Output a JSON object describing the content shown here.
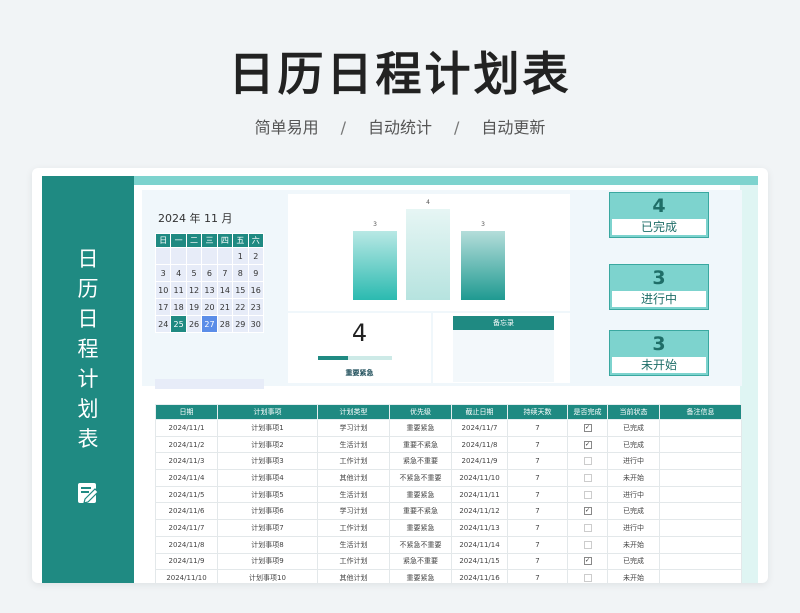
{
  "header": {
    "title": "日历日程计划表",
    "subtitle": [
      "简单易用",
      "自动统计",
      "自动更新"
    ],
    "separator": "/"
  },
  "sidebar": {
    "title_chars": [
      "日",
      "历",
      "日",
      "程",
      "计",
      "划",
      "表"
    ],
    "icon": "edit-icon"
  },
  "calendar": {
    "year": "2024",
    "year_unit": "年",
    "month": "11",
    "month_unit": "月",
    "weekdays": [
      "日",
      "一",
      "二",
      "三",
      "四",
      "五",
      "六"
    ],
    "weeks": [
      [
        "",
        "",
        "",
        "",
        "",
        "1",
        "2"
      ],
      [
        "3",
        "4",
        "5",
        "6",
        "7",
        "8",
        "9"
      ],
      [
        "10",
        "11",
        "12",
        "13",
        "14",
        "15",
        "16"
      ],
      [
        "17",
        "18",
        "19",
        "20",
        "21",
        "22",
        "23"
      ],
      [
        "24",
        "25",
        "26",
        "27",
        "28",
        "29",
        "30"
      ]
    ],
    "highlight_primary": "25",
    "highlight_secondary": "27"
  },
  "chart_data": {
    "type": "bar",
    "categories": [
      "",
      "",
      ""
    ],
    "values": [
      3,
      4,
      3
    ],
    "ylim": [
      0,
      4.2
    ],
    "grid": false,
    "colors": [
      "#2bbab0",
      "#b6e3df",
      "#1f9a91"
    ]
  },
  "urgent_panel": {
    "value": "4",
    "label": "重要紧急",
    "progress": 0.4
  },
  "memo": {
    "label": "备忘录"
  },
  "stats": [
    {
      "value": "4",
      "label": "已完成"
    },
    {
      "value": "3",
      "label": "进行中"
    },
    {
      "value": "3",
      "label": "未开始"
    }
  ],
  "table": {
    "columns": [
      "日期",
      "计划事项",
      "计划类型",
      "优先级",
      "截止日期",
      "持续天数",
      "是否完成",
      "当前状态",
      "备注信息"
    ],
    "rows": [
      [
        "2024/11/1",
        "计划事项1",
        "学习计划",
        "重要紧急",
        "2024/11/7",
        "7",
        true,
        "已完成",
        ""
      ],
      [
        "2024/11/2",
        "计划事项2",
        "生活计划",
        "重要不紧急",
        "2024/11/8",
        "7",
        true,
        "已完成",
        ""
      ],
      [
        "2024/11/3",
        "计划事项3",
        "工作计划",
        "紧急不重要",
        "2024/11/9",
        "7",
        false,
        "进行中",
        ""
      ],
      [
        "2024/11/4",
        "计划事项4",
        "其他计划",
        "不紧急不重要",
        "2024/11/10",
        "7",
        false,
        "未开始",
        ""
      ],
      [
        "2024/11/5",
        "计划事项5",
        "生活计划",
        "重要紧急",
        "2024/11/11",
        "7",
        false,
        "进行中",
        ""
      ],
      [
        "2024/11/6",
        "计划事项6",
        "学习计划",
        "重要不紧急",
        "2024/11/12",
        "7",
        true,
        "已完成",
        ""
      ],
      [
        "2024/11/7",
        "计划事项7",
        "工作计划",
        "重要紧急",
        "2024/11/13",
        "7",
        false,
        "进行中",
        ""
      ],
      [
        "2024/11/8",
        "计划事项8",
        "生活计划",
        "不紧急不重要",
        "2024/11/14",
        "7",
        false,
        "未开始",
        ""
      ],
      [
        "2024/11/9",
        "计划事项9",
        "工作计划",
        "紧急不重要",
        "2024/11/15",
        "7",
        true,
        "已完成",
        ""
      ],
      [
        "2024/11/10",
        "计划事项10",
        "其他计划",
        "重要紧急",
        "2024/11/16",
        "7",
        false,
        "未开始",
        ""
      ]
    ]
  },
  "colors": {
    "accent": "#1f8a82",
    "accent_light": "#7dd3ce",
    "calendar_cell": "#e7ecf8",
    "selected_blue": "#5b8de8"
  }
}
